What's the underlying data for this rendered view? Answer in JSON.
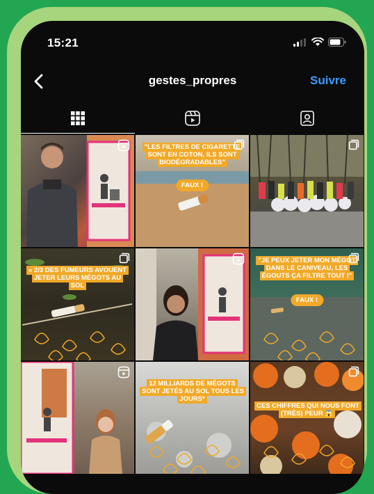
{
  "status_bar": {
    "time": "15:21"
  },
  "header": {
    "username": "gestes_propres",
    "follow_label": "Suivre"
  },
  "tabs": [
    {
      "name": "grid"
    },
    {
      "name": "reels"
    },
    {
      "name": "tagged"
    }
  ],
  "posts": [
    {
      "kind": "reel",
      "caption": ""
    },
    {
      "kind": "carousel",
      "caption": "\"LES FILTRES DE CIGARETTE SONT EN COTON, ILS SONT BIODÉGRADABLES\"",
      "pill": "FAUX !"
    },
    {
      "kind": "carousel",
      "caption": ""
    },
    {
      "kind": "carousel",
      "caption": "« 2/3 DES FUMEURS AVOUENT JETER LEURS MÉGOTS AU SOL"
    },
    {
      "kind": "reel",
      "caption": ""
    },
    {
      "kind": "carousel",
      "caption": "\"JE PEUX JETER MON MÉGOT DANS LE CANIVEAU, LES ÉGOUTS ÇA FILTRE TOUT !\"",
      "pill": "FAUX !"
    },
    {
      "kind": "reel",
      "caption": ""
    },
    {
      "kind": "carousel",
      "caption": "12 MILLIARDS DE MÉGOTS SONT JETÉS AU SOL TOUS LES JOURS*"
    },
    {
      "kind": "carousel",
      "caption": "CES CHIFFRES QUI NOUS FONT (TRÈS) PEUR 😱"
    }
  ],
  "colors": {
    "accent": "#3d9bff",
    "brand_orange": "#f0a928",
    "background": "#23a652"
  }
}
